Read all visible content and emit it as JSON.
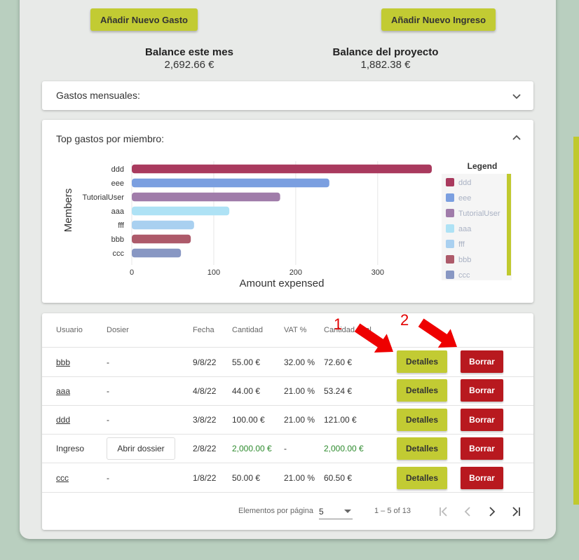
{
  "actions": {
    "add_expense": "Añadir Nuevo Gasto",
    "add_income": "Añadir Nuevo Ingreso"
  },
  "balances": {
    "month_label": "Balance este mes",
    "month_value": "2,692.66 €",
    "project_label": "Balance del proyecto",
    "project_value": "1,882.38 €"
  },
  "monthly": {
    "title": "Gastos mensuales:"
  },
  "top": {
    "title": "Top gastos por miembro:",
    "legend_title": "Legend"
  },
  "chart_data": {
    "type": "bar",
    "orientation": "horizontal",
    "categories": [
      "ddd",
      "eee",
      "TutorialUser",
      "aaa",
      "fff",
      "bbb",
      "ccc"
    ],
    "values": [
      366,
      241,
      181,
      119,
      76,
      72,
      60
    ],
    "colors": [
      "#a93a5e",
      "#7b9fe0",
      "#a07caa",
      "#aee2f5",
      "#a9d0f0",
      "#ad5a6a",
      "#8897c3"
    ],
    "xlabel": "Amount expensed",
    "ylabel": "Members",
    "xticks": [
      0,
      100,
      200,
      300
    ],
    "xlim": [
      0,
      366
    ],
    "grid": true,
    "legend": [
      "ddd",
      "eee",
      "TutorialUser",
      "aaa",
      "fff",
      "bbb",
      "ccc"
    ],
    "legend_position": "right"
  },
  "table": {
    "headers": [
      "Usuario",
      "Dosier",
      "Fecha",
      "Cantidad",
      "VAT %",
      "Cantidad total"
    ],
    "details_label": "Detalles",
    "delete_label": "Borrar",
    "rows": [
      {
        "user": "bbb",
        "dossier": "-",
        "date": "9/8/22",
        "amount": "55.00 €",
        "vat": "32.00 %",
        "total": "72.60 €"
      },
      {
        "user": "aaa",
        "dossier": "-",
        "date": "4/8/22",
        "amount": "44.00 €",
        "vat": "21.00 %",
        "total": "53.24 €"
      },
      {
        "user": "ddd",
        "dossier": "-",
        "date": "3/8/22",
        "amount": "100.00 €",
        "vat": "21.00 %",
        "total": "121.00 €"
      },
      {
        "user": "Ingreso",
        "dossier": "Abrir dossier",
        "date": "2/8/22",
        "amount": "2,000.00 €",
        "vat": "-",
        "total": "2,000.00 €"
      },
      {
        "user": "ccc",
        "dossier": "-",
        "date": "1/8/22",
        "amount": "50.00 €",
        "vat": "21.00 %",
        "total": "60.50 €"
      }
    ]
  },
  "paginator": {
    "label": "Elementos por página",
    "size": "5",
    "range": "1 – 5 of 13"
  },
  "annotations": {
    "one": "1",
    "two": "2",
    "arrow_color": "#ee0000"
  }
}
